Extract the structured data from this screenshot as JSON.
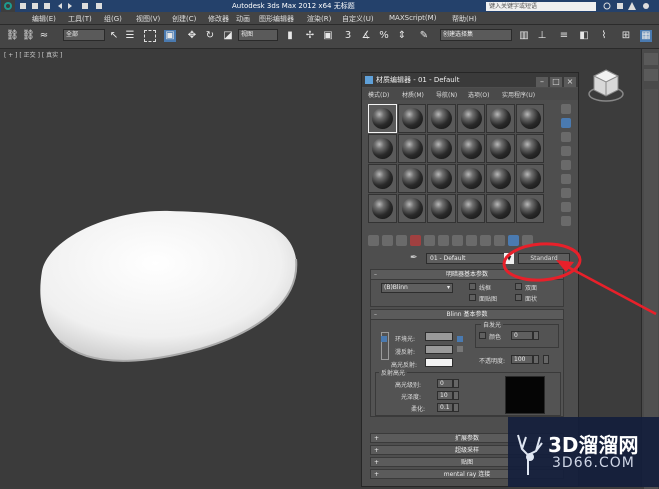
{
  "titlebar": {
    "title": "Autodesk 3ds Max  2012 x64    无标题",
    "search_placeholder": "键入关键字或短语"
  },
  "menubar": {
    "items": [
      "编辑(E)",
      "工具(T)",
      "组(G)",
      "视图(V)",
      "创建(C)",
      "修改器",
      "动画",
      "图形编辑器",
      "渲染(R)",
      "自定义(U)",
      "MAXScript(M)",
      "帮助(H)"
    ]
  },
  "toolbar": {
    "selection_filter": "全部",
    "ref_coord": "视图",
    "named_selection": "创建选择集"
  },
  "viewport": {
    "label": "[ + ] [ 正交 ] [ 真实 ]"
  },
  "material_editor": {
    "title": "材质编辑器 - 01 - Default",
    "menu": [
      "模式(D)",
      "材质(M)",
      "导航(N)",
      "选项(O)",
      "实用程序(U)"
    ],
    "material_name": "01 - Default",
    "type_button": "Standard",
    "shader_rollout": {
      "title": "明暗器基本参数",
      "shader": "(B)Blinn",
      "wire": "线框",
      "two_sided": "双面",
      "face_map": "面贴图",
      "faceted": "面状"
    },
    "blinn_rollout": {
      "title": "Blinn 基本参数",
      "self_illum_title": "自发光",
      "color_label": "颜色",
      "color_value": "0",
      "ambient": "环境光:",
      "diffuse": "漫反射:",
      "specular": "高光反射:",
      "opacity_label": "不透明度:",
      "opacity_value": "100"
    },
    "spec_highlights": {
      "title": "反射高光",
      "spec_level_label": "高光级别:",
      "spec_level": "0",
      "gloss_label": "光泽度:",
      "gloss": "10",
      "soften_label": "柔化:",
      "soften": "0.1"
    },
    "collapsed_rollouts": [
      "扩展参数",
      "超级采样",
      "贴图",
      "mental ray 连接"
    ]
  },
  "watermark": {
    "brand": "3D溜溜网",
    "domain": "3D66.COM"
  },
  "annotation_color": "#e8202a"
}
